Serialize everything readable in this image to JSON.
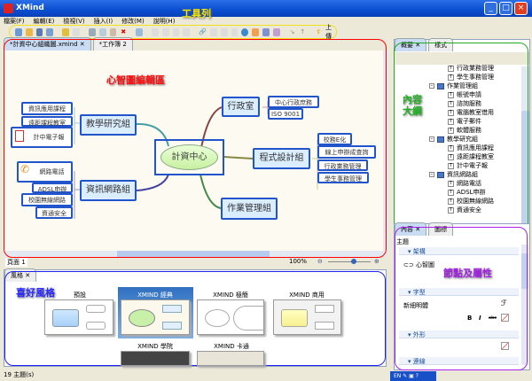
{
  "window": {
    "title": "XMind",
    "minimize": "_",
    "maximize": "□",
    "close": "×"
  },
  "menu": [
    "檔案(F)",
    "編輯(E)",
    "檢視(V)",
    "插入(I)",
    "修改(M)",
    "說明(H)"
  ],
  "toolbar": {
    "upload_label": "上傳"
  },
  "callouts": {
    "toolbar": "工具列",
    "editor": "心智圖編輯區",
    "outline": "內容大綱",
    "properties": "節點及屬性",
    "styles": "喜好風格"
  },
  "editor": {
    "tabs": [
      {
        "label": "*計資中心組織圖.xmind",
        "active": true
      },
      {
        "label": "*工作簿 2",
        "active": false
      }
    ],
    "map": {
      "central": "計資中心",
      "topics": {
        "admin": {
          "label": "行政室",
          "children": [
            "中心行政庶務",
            "ISO 9001"
          ]
        },
        "programming": {
          "label": "程式設計組",
          "children": [
            "校務E化",
            "線上申辦成查詢",
            "行政業務管理",
            "學生事務管理"
          ]
        },
        "operations": {
          "label": "作業管理組"
        },
        "teaching": {
          "label": "教學研究組",
          "children": [
            "資訊應用課程",
            "遠距課程教室",
            "計中電子報"
          ]
        },
        "network": {
          "label": "資訊網路組",
          "children": [
            "網路電話",
            "ADSL申辦",
            "校園無線網路",
            "資通安全"
          ]
        }
      }
    },
    "sheet": "頁面 1",
    "zoom": "100%"
  },
  "outline": {
    "tabs": [
      "概要",
      "樣式"
    ],
    "items": [
      {
        "label": "行政業務管理",
        "level": 2
      },
      {
        "label": "學生事務管理",
        "level": 2
      },
      {
        "label": "作業管理組",
        "level": 1
      },
      {
        "label": "帳號申請",
        "level": 2
      },
      {
        "label": "諮詢服務",
        "level": 2
      },
      {
        "label": "電腦教室借用",
        "level": 2
      },
      {
        "label": "電子郵件",
        "level": 2
      },
      {
        "label": "軟體服務",
        "level": 2
      },
      {
        "label": "教學研究組",
        "level": 1
      },
      {
        "label": "資訊應用課程",
        "level": 2
      },
      {
        "label": "遠距課程教室",
        "level": 2
      },
      {
        "label": "計中電子報",
        "level": 2
      },
      {
        "label": "資訊網路組",
        "level": 1
      },
      {
        "label": "網路電話",
        "level": 2
      },
      {
        "label": "ADSL申辦",
        "level": 2
      },
      {
        "label": "校園無線網路",
        "level": 2
      },
      {
        "label": "資通安全",
        "level": 2
      }
    ]
  },
  "properties": {
    "tabs": [
      "內容",
      "圖標"
    ],
    "heading": "主題",
    "sections": {
      "structure": "架構",
      "font": "字型",
      "shape": "外形",
      "line": "連線"
    },
    "structure_value": "心智圖",
    "font_value": "新細明體",
    "bold": "B",
    "italic": "I",
    "strike": "abc"
  },
  "styles": {
    "tab": "風格",
    "items": [
      {
        "label": "預設"
      },
      {
        "label": "XMIND 經典",
        "selected": true
      },
      {
        "label": "XMIND 極簡"
      },
      {
        "label": "XMIND 商用"
      },
      {
        "label": "XMIND 學院"
      },
      {
        "label": "XMIND 卡通"
      }
    ]
  },
  "status": {
    "topics": "19 主題(s)",
    "lang": "EN"
  },
  "colors": {
    "titlebar": "#0a4ed0",
    "node_border": "#2255cc",
    "canvas": "#fdfbf1",
    "editor_outline": "#ff0000",
    "outline_border": "#22aa22",
    "properties_border": "#aa22ee",
    "styles_border": "#2222ee",
    "toolbar_outline": "#f0e020"
  }
}
